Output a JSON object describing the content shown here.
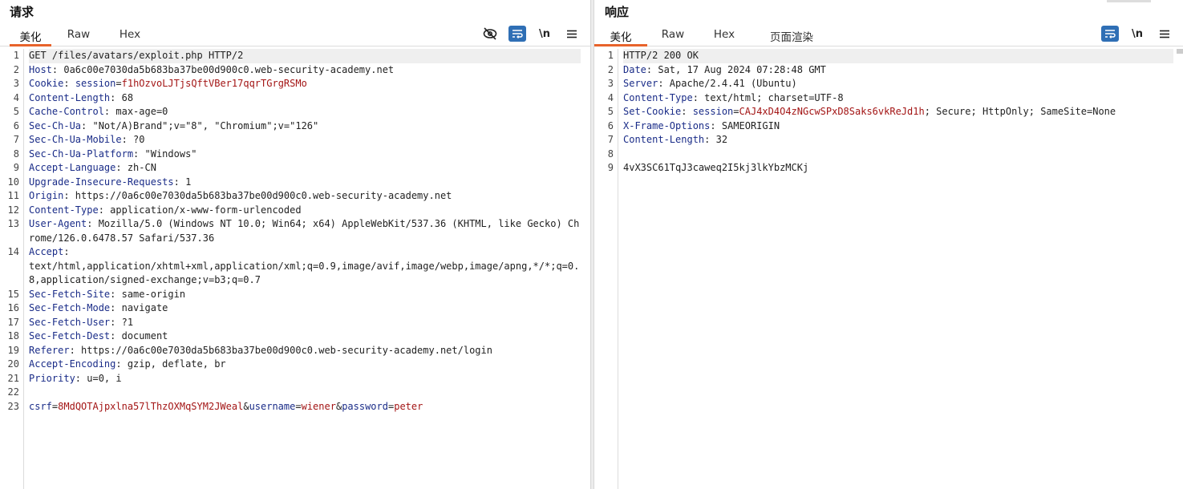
{
  "request": {
    "title": "请求",
    "tabs": [
      "美化",
      "Raw",
      "Hex"
    ],
    "active_tab": "美化",
    "toolbar": {
      "hide_icon": "eye-off-icon",
      "wrap_icon": "wrap-icon",
      "newline_label": "\\n",
      "menu_icon": "menu-icon"
    },
    "lines": [
      {
        "n": "1",
        "parts": [
          [
            "v",
            "GET /files/avatars/exploit.php HTTP/2"
          ]
        ]
      },
      {
        "n": "2",
        "parts": [
          [
            "k",
            "Host"
          ],
          [
            "v",
            ": 0a6c00e7030da5b683ba37be00d900c0.web-security-academy.net"
          ]
        ]
      },
      {
        "n": "3",
        "parts": [
          [
            "k",
            "Cookie"
          ],
          [
            "v",
            ": "
          ],
          [
            "k",
            "session"
          ],
          [
            "v",
            "="
          ],
          [
            "cv",
            "f1hOzvoLJTjsQftVBer17qqrTGrgRSMo"
          ]
        ]
      },
      {
        "n": "4",
        "parts": [
          [
            "k",
            "Content-Length"
          ],
          [
            "v",
            ": 68"
          ]
        ]
      },
      {
        "n": "5",
        "parts": [
          [
            "k",
            "Cache-Control"
          ],
          [
            "v",
            ": max-age=0"
          ]
        ]
      },
      {
        "n": "6",
        "parts": [
          [
            "k",
            "Sec-Ch-Ua"
          ],
          [
            "v",
            ": \"Not/A)Brand\";v=\"8\", \"Chromium\";v=\"126\""
          ]
        ]
      },
      {
        "n": "7",
        "parts": [
          [
            "k",
            "Sec-Ch-Ua-Mobile"
          ],
          [
            "v",
            ": ?0"
          ]
        ]
      },
      {
        "n": "8",
        "parts": [
          [
            "k",
            "Sec-Ch-Ua-Platform"
          ],
          [
            "v",
            ": \"Windows\""
          ]
        ]
      },
      {
        "n": "9",
        "parts": [
          [
            "k",
            "Accept-Language"
          ],
          [
            "v",
            ": zh-CN"
          ]
        ]
      },
      {
        "n": "10",
        "parts": [
          [
            "k",
            "Upgrade-Insecure-Requests"
          ],
          [
            "v",
            ": 1"
          ]
        ]
      },
      {
        "n": "11",
        "parts": [
          [
            "k",
            "Origin"
          ],
          [
            "v",
            ": https://0a6c00e7030da5b683ba37be00d900c0.web-security-academy.net"
          ]
        ]
      },
      {
        "n": "12",
        "parts": [
          [
            "k",
            "Content-Type"
          ],
          [
            "v",
            ": application/x-www-form-urlencoded"
          ]
        ]
      },
      {
        "n": "13",
        "parts": [
          [
            "k",
            "User-Agent"
          ],
          [
            "v",
            ": Mozilla/5.0 (Windows NT 10.0; Win64; x64) AppleWebKit/537.36 (KHTML, like Gecko) Chrome/126.0.6478.57 Safari/537.36"
          ]
        ]
      },
      {
        "n": "14",
        "parts": [
          [
            "k",
            "Accept"
          ],
          [
            "v",
            ":\ntext/html,application/xhtml+xml,application/xml;q=0.9,image/avif,image/webp,image/apng,*/*;q=0.8,application/signed-exchange;v=b3;q=0.7"
          ]
        ]
      },
      {
        "n": "15",
        "parts": [
          [
            "k",
            "Sec-Fetch-Site"
          ],
          [
            "v",
            ": same-origin"
          ]
        ]
      },
      {
        "n": "16",
        "parts": [
          [
            "k",
            "Sec-Fetch-Mode"
          ],
          [
            "v",
            ": navigate"
          ]
        ]
      },
      {
        "n": "17",
        "parts": [
          [
            "k",
            "Sec-Fetch-User"
          ],
          [
            "v",
            ": ?1"
          ]
        ]
      },
      {
        "n": "18",
        "parts": [
          [
            "k",
            "Sec-Fetch-Dest"
          ],
          [
            "v",
            ": document"
          ]
        ]
      },
      {
        "n": "19",
        "parts": [
          [
            "k",
            "Referer"
          ],
          [
            "v",
            ": https://0a6c00e7030da5b683ba37be00d900c0.web-security-academy.net/login"
          ]
        ]
      },
      {
        "n": "20",
        "parts": [
          [
            "k",
            "Accept-Encoding"
          ],
          [
            "v",
            ": gzip, deflate, br"
          ]
        ]
      },
      {
        "n": "21",
        "parts": [
          [
            "k",
            "Priority"
          ],
          [
            "v",
            ": u=0, i"
          ]
        ]
      },
      {
        "n": "22",
        "parts": [
          [
            "v",
            ""
          ]
        ]
      },
      {
        "n": "23",
        "parts": [
          [
            "pk",
            "csrf"
          ],
          [
            "v",
            "="
          ],
          [
            "pv",
            "8MdQOTAjpxlna57lThzOXMqSYM2JWeal"
          ],
          [
            "v",
            "&"
          ],
          [
            "pk",
            "username"
          ],
          [
            "v",
            "="
          ],
          [
            "pv",
            "wiener"
          ],
          [
            "v",
            "&"
          ],
          [
            "pk",
            "password"
          ],
          [
            "v",
            "="
          ],
          [
            "pv",
            "peter"
          ]
        ]
      }
    ]
  },
  "response": {
    "title": "响应",
    "tabs": [
      "美化",
      "Raw",
      "Hex",
      "页面渲染"
    ],
    "active_tab": "美化",
    "toolbar": {
      "wrap_icon": "wrap-icon",
      "newline_label": "\\n",
      "menu_icon": "menu-icon"
    },
    "lines": [
      {
        "n": "1",
        "parts": [
          [
            "v",
            "HTTP/2 200 OK"
          ]
        ]
      },
      {
        "n": "2",
        "parts": [
          [
            "k",
            "Date"
          ],
          [
            "v",
            ": Sat, 17 Aug 2024 07:28:48 GMT"
          ]
        ]
      },
      {
        "n": "3",
        "parts": [
          [
            "k",
            "Server"
          ],
          [
            "v",
            ": Apache/2.4.41 (Ubuntu)"
          ]
        ]
      },
      {
        "n": "4",
        "parts": [
          [
            "k",
            "Content-Type"
          ],
          [
            "v",
            ": text/html; charset=UTF-8"
          ]
        ]
      },
      {
        "n": "5",
        "parts": [
          [
            "k",
            "Set-Cookie"
          ],
          [
            "v",
            ": "
          ],
          [
            "k",
            "session"
          ],
          [
            "v",
            "="
          ],
          [
            "cv",
            "CAJ4xD4O4zNGcwSPxD8Saks6vkReJd1h"
          ],
          [
            "v",
            "; Secure; HttpOnly; SameSite=None"
          ]
        ]
      },
      {
        "n": "6",
        "parts": [
          [
            "k",
            "X-Frame-Options"
          ],
          [
            "v",
            ": SAMEORIGIN"
          ]
        ]
      },
      {
        "n": "7",
        "parts": [
          [
            "k",
            "Content-Length"
          ],
          [
            "v",
            ": 32"
          ]
        ]
      },
      {
        "n": "8",
        "parts": [
          [
            "v",
            ""
          ]
        ]
      },
      {
        "n": "9",
        "parts": [
          [
            "v",
            "4vX3SC61TqJ3caweq2I5kj3lkYbzMCKj"
          ]
        ]
      }
    ]
  }
}
